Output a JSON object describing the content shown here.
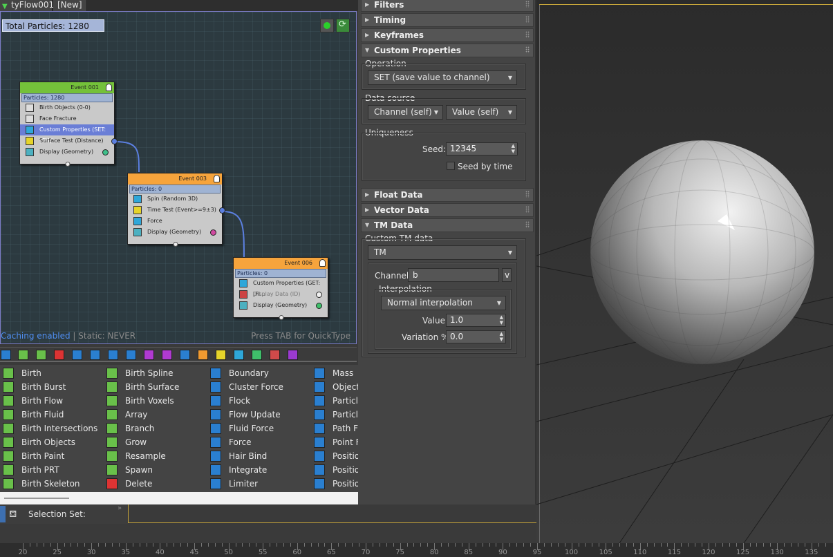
{
  "tabs": [
    "tyFlow001",
    "[New]"
  ],
  "graph": {
    "total_particles": "Total Particles: 1280",
    "caching": "Caching enabled",
    "static": " | Static: NEVER",
    "hint": "Press TAB for QuickType",
    "events": [
      {
        "title": "Event 001",
        "particles": "Particles: 1280",
        "operators": [
          "Birth Objects (0-0)",
          "Face Fracture",
          "Custom Properties (SET: [TM])",
          "Surface Test (Distance)",
          "Display (Geometry)"
        ]
      },
      {
        "title": "Event 003",
        "particles": "Particles: 0",
        "operators": [
          "Spin (Random 3D)",
          "Time Test (Event>=9±3)",
          "Force",
          "Display (Geometry)"
        ]
      },
      {
        "title": "Event 006",
        "particles": "Particles: 0",
        "operators": [
          "Custom Properties (GET: [Fl...",
          "Display Data (ID)",
          "Display (Geometry)"
        ]
      }
    ]
  },
  "operator_list": {
    "col1": [
      "Birth",
      "Birth Burst",
      "Birth Flow",
      "Birth Fluid",
      "Birth Intersections",
      "Birth Objects",
      "Birth Paint",
      "Birth PRT",
      "Birth Skeleton"
    ],
    "col2": [
      "Birth Spline",
      "Birth Surface",
      "Birth Voxels",
      "Array",
      "Branch",
      "Grow",
      "Resample",
      "Spawn",
      "Delete"
    ],
    "col3": [
      "Boundary",
      "Cluster Force",
      "Flock",
      "Flow Update",
      "Fluid Force",
      "Force",
      "Hair Bind",
      "Integrate",
      "Limiter"
    ],
    "col4": [
      "Mass",
      "Object",
      "Particle",
      "Particle",
      "Path Fo",
      "Point F",
      "Positio",
      "Positio",
      "Positio"
    ]
  },
  "selection_set_label": "Selection Set:",
  "panel": {
    "rollouts": {
      "filters": "Filters",
      "timing": "Timing",
      "keyframes": "Keyframes",
      "custom_properties": "Custom Properties",
      "float_data": "Float Data",
      "vector_data": "Vector Data",
      "tm_data": "TM Data"
    },
    "operation_label": "Operation",
    "operation_value": "SET (save value to channel)",
    "data_source_label": "Data source",
    "data_source_channel": "Channel (self)",
    "data_source_value": "Value (self)",
    "uniqueness_label": "Uniqueness",
    "seed_label": "Seed:",
    "seed_value": "12345",
    "seed_by_time": "Seed by time",
    "custom_tm_label": "Custom TM data",
    "custom_tm_value": "TM",
    "channel_label": "Channel:",
    "channel_value": "b",
    "channel_button": "v",
    "interpolation_label": "Interpolation",
    "interpolation_value": "Normal interpolation",
    "value_label": "Value:",
    "value_value": "1.0",
    "variation_label": "Variation %:",
    "variation_value": "0.0"
  },
  "ruler_labels": [
    "20",
    "25",
    "30",
    "35",
    "40",
    "45",
    "50",
    "55",
    "60",
    "65",
    "70",
    "75",
    "80",
    "85",
    "90",
    "95",
    "100",
    "105",
    "110",
    "115",
    "120",
    "125",
    "130",
    "135"
  ],
  "colors": {
    "event_green": "#74c13a",
    "event_orange": "#f6a43c",
    "selection_blue": "#6a7ed6",
    "particles_bar": "#9fb3d3",
    "wire": "#5b7fe0"
  }
}
